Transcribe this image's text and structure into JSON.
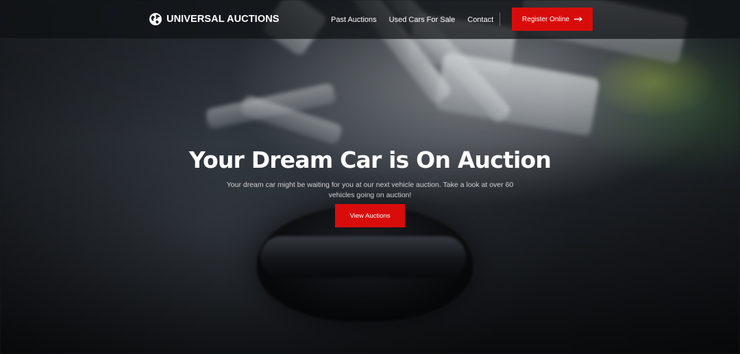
{
  "header": {
    "brand_name": "UNIVERSAL AUCTIONS",
    "brand_icon": "globe-icon",
    "nav": [
      {
        "label": "Past Auctions"
      },
      {
        "label": "Used Cars For Sale"
      },
      {
        "label": "Contact"
      }
    ],
    "register_label": "Register Online",
    "register_icon": "arrow-right-icon"
  },
  "hero": {
    "title": "Your Dream Car is On Auction",
    "subtitle": "Your dream car might be waiting for you at our next vehicle auction. Take a look at over 60 vehicles going on auction!",
    "cta_label": "View Auctions"
  },
  "colors": {
    "accent": "#d90c0c",
    "header_bg": "#0e1013",
    "text": "#ffffff"
  }
}
